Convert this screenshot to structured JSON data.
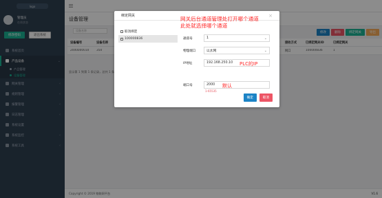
{
  "app": {
    "logo_text": "logo"
  },
  "profile": {
    "name": "管理员",
    "status": "在线状态"
  },
  "sidebar": {
    "primary_button": "修改密码",
    "secondary_button": "退出系统",
    "items": [
      {
        "label": "系统首页",
        "icon": "home-icon"
      },
      {
        "label": "产品设备",
        "icon": "box-icon",
        "active": true,
        "children": [
          {
            "label": "产品管理"
          },
          {
            "label": "设备管理",
            "current": true
          }
        ]
      },
      {
        "label": "网关管理",
        "icon": "gateway-icon"
      },
      {
        "label": "规则管理",
        "icon": "rule-icon"
      },
      {
        "label": "报警管理",
        "icon": "alarm-icon"
      },
      {
        "label": "日志管理",
        "icon": "log-icon"
      },
      {
        "label": "系统设置",
        "icon": "gear-icon"
      },
      {
        "label": "系统监控",
        "icon": "monitor-icon"
      },
      {
        "label": "系统工具",
        "icon": "tool-icon"
      }
    ]
  },
  "main": {
    "title": "设备管理",
    "search_placeholder": "设备名称",
    "toolbar": {
      "edit_label": "修改",
      "delete_label": "删除",
      "bind_label": "绑定网关",
      "export_label": "导出"
    },
    "table": {
      "headers": [
        "设备编号",
        "设备名称",
        "",
        "",
        "",
        "",
        "",
        "接收名称",
        "接收方式",
        "已绑定网关ID",
        "已绑定网关"
      ],
      "rows": [
        [
          "2000000010",
          "350",
          "",
          "",
          "",
          "",
          "",
          "shebei_k_ty",
          "网口",
          "100000836",
          "1"
        ]
      ]
    },
    "page_info": "显示第 1 到第 1 条记录，总共 1 条记录"
  },
  "modal": {
    "title": "绑定网关",
    "annotation_line1": "网关后台通道管理处打开哪个通道",
    "annotation_line2": "此处就选择哪个通道",
    "tree": [
      {
        "label": "取消绑定",
        "checked": false
      },
      {
        "label": "100000836",
        "checked": true,
        "selected": true
      }
    ],
    "form": {
      "channel_label": "通道号",
      "channel_value": "1",
      "port_label": "物理端口",
      "port_value": "以太网",
      "ip_label": "IP地址",
      "ip_value": "192.168.250.10",
      "ip_annotation": "PLC的IP",
      "port_num_label": "端口号",
      "port_num_value": "2000",
      "port_num_annotation": "默认",
      "port_hint": "1-65535"
    },
    "confirm_label": "确定",
    "cancel_label": "取消"
  },
  "footer": {
    "copyright": "Copyright © 2019 物联网平台 ",
    "version": "V1.6"
  },
  "colors": {
    "sidebar_bg": "#2f4050",
    "accent": "#1ab394",
    "annotation_red": "#ff2a2a",
    "confirm_blue": "#1c84c6",
    "cancel_red": "#ed5565"
  }
}
